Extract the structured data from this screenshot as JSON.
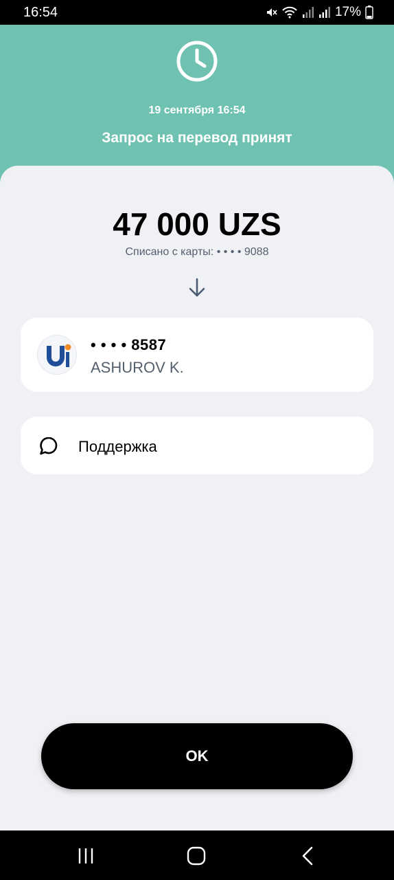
{
  "status_bar": {
    "time": "16:54",
    "battery_percent": "17%",
    "icons": [
      "mute-icon",
      "wifi-icon",
      "signal-icon",
      "signal-icon",
      "battery-icon"
    ]
  },
  "header": {
    "icon": "clock-icon",
    "date": "19 сентября 16:54",
    "title": "Запрос на перевод принят",
    "background_color": "#6fc2b2"
  },
  "transfer": {
    "amount": "47 000 UZS",
    "debited_from": "Списано с карты:  • • • • 9088",
    "arrow_icon": "arrow-down-icon"
  },
  "recipient": {
    "card_number": "• • • • 8587",
    "name": "ASHUROV K.",
    "logo_icon": "bank-logo-icon"
  },
  "support": {
    "icon": "chat-bubble-icon",
    "label": "Поддержка"
  },
  "ok_button": {
    "label": "OK"
  },
  "nav_bar": {
    "icons": [
      "recent-apps-icon",
      "home-icon",
      "back-icon"
    ]
  }
}
